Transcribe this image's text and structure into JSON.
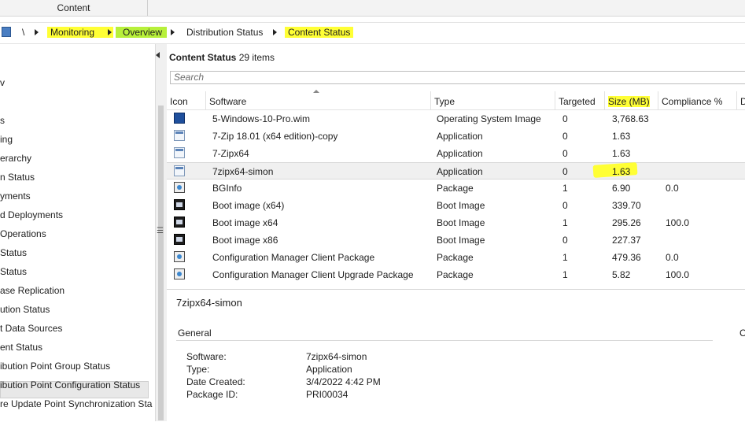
{
  "ribbon": {
    "tab_label": "Content"
  },
  "breadcrumb": {
    "root": "\\",
    "items": [
      "Monitoring",
      "Overview",
      "Distribution Status",
      "Content Status"
    ]
  },
  "nav": {
    "items": [
      "v",
      "s",
      "ing",
      "erarchy",
      "n Status",
      "yments",
      "d Deployments",
      "Operations",
      "Status",
      "Status",
      "ase Replication",
      "ution Status",
      "t Data Sources",
      "ent Status",
      "ibution Point Group Status",
      "ibution Point Configuration Status",
      "re Update Point Synchronization Sta"
    ],
    "selected_index": 13
  },
  "main": {
    "title": "Content Status",
    "count": "29 items",
    "search_placeholder": "Search",
    "columns": [
      "Icon",
      "Software",
      "Type",
      "Targeted",
      "Size (MB)",
      "Compliance %",
      "D"
    ],
    "rows": [
      {
        "icon": "os-image-icon",
        "software": "5-Windows-10-Pro.wim",
        "type": "Operating System Image",
        "targeted": "0",
        "size": "3,768.63",
        "compliance": ""
      },
      {
        "icon": "application-icon",
        "software": "7-Zip 18.01 (x64 edition)-copy",
        "type": "Application",
        "targeted": "0",
        "size": "1.63",
        "compliance": ""
      },
      {
        "icon": "application-icon",
        "software": "7-Zipx64",
        "type": "Application",
        "targeted": "0",
        "size": "1.63",
        "compliance": ""
      },
      {
        "icon": "application-icon",
        "software": "7zipx64-simon",
        "type": "Application",
        "targeted": "0",
        "size": "1.63",
        "compliance": ""
      },
      {
        "icon": "package-icon",
        "software": "BGInfo",
        "type": "Package",
        "targeted": "1",
        "size": "6.90",
        "compliance": "0.0"
      },
      {
        "icon": "boot-image-icon",
        "software": "Boot image (x64)",
        "type": "Boot Image",
        "targeted": "0",
        "size": "339.70",
        "compliance": ""
      },
      {
        "icon": "boot-image-icon",
        "software": "Boot image x64",
        "type": "Boot Image",
        "targeted": "1",
        "size": "295.26",
        "compliance": "100.0"
      },
      {
        "icon": "boot-image-icon",
        "software": "Boot image x86",
        "type": "Boot Image",
        "targeted": "0",
        "size": "227.37",
        "compliance": ""
      },
      {
        "icon": "package-icon",
        "software": "Configuration Manager Client Package",
        "type": "Package",
        "targeted": "1",
        "size": "479.36",
        "compliance": "0.0"
      },
      {
        "icon": "package-icon",
        "software": "Configuration Manager Client Upgrade Package",
        "type": "Package",
        "targeted": "1",
        "size": "5.82",
        "compliance": "100.0"
      }
    ],
    "selected_row": 3
  },
  "details": {
    "title": "7zipx64-simon",
    "section": "General",
    "right_label": "C",
    "fields": [
      {
        "label": "Software:",
        "value": "7zipx64-simon"
      },
      {
        "label": "Type:",
        "value": "Application"
      },
      {
        "label": "Date Created:",
        "value": "3/4/2022 4:42 PM"
      },
      {
        "label": "Package ID:",
        "value": "PRI00034"
      }
    ]
  },
  "colors": {
    "highlight_yellow": "#ffff35",
    "highlight_green": "#b7f03a"
  }
}
